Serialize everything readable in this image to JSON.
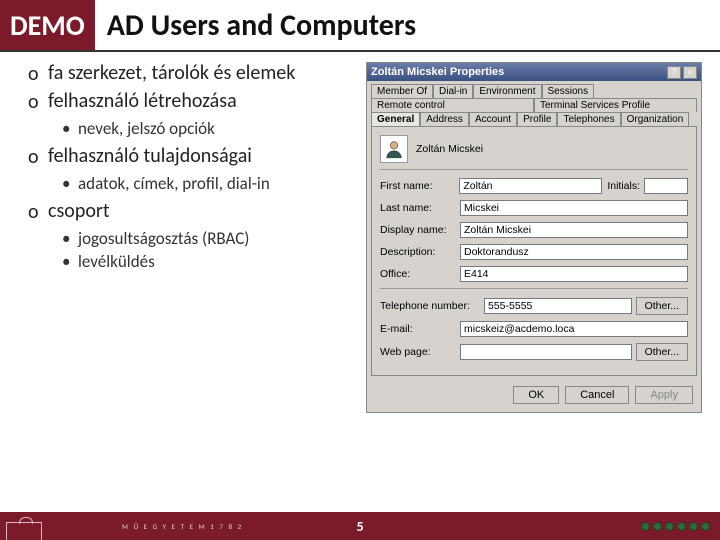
{
  "header": {
    "badge": "DEMO",
    "title": "AD Users and Computers"
  },
  "bullets": [
    {
      "text": "fa szerkezet, tárolók és elemek",
      "sub": []
    },
    {
      "text": "felhasználó létrehozása",
      "sub": [
        "nevek, jelszó opciók"
      ]
    },
    {
      "text": "felhasználó tulajdonságai",
      "sub": [
        "adatok, címek, profil, dial-in"
      ]
    },
    {
      "text": "csoport",
      "sub": [
        "jogosultságosztás (RBAC)",
        "levélküldés"
      ]
    }
  ],
  "dialog": {
    "title": "Zoltán Micskei Properties",
    "help_icon": "?",
    "close_icon": "×",
    "tabs_row1": [
      "Member Of",
      "Dial-in",
      "Environment",
      "Sessions"
    ],
    "tabs_row2_left": "Remote control",
    "tabs_row2_right": "Terminal Services Profile",
    "tabs_row3": [
      "General",
      "Address",
      "Account",
      "Profile",
      "Telephones",
      "Organization"
    ],
    "display_name_top": "Zoltán Micskei",
    "fields": {
      "first_name_label": "First name:",
      "first_name_value": "Zoltán",
      "initials_label": "Initials:",
      "initials_value": "",
      "last_name_label": "Last name:",
      "last_name_value": "Micskei",
      "display_label": "Display name:",
      "display_value": "Zoltán Micskei",
      "description_label": "Description:",
      "description_value": "Doktorandusz",
      "office_label": "Office:",
      "office_value": "E414",
      "telephone_label": "Telephone number:",
      "telephone_value": "555-5555",
      "other1_label": "Other...",
      "email_label": "E-mail:",
      "email_value": "micskeiz@acdemo.loca",
      "web_label": "Web page:",
      "web_value": "",
      "other2_label": "Other..."
    },
    "buttons": {
      "ok": "OK",
      "cancel": "Cancel",
      "apply": "Apply"
    }
  },
  "footer": {
    "page_number": "5",
    "university_text": "M Ű E G Y E T E M   1 7 8 2"
  }
}
